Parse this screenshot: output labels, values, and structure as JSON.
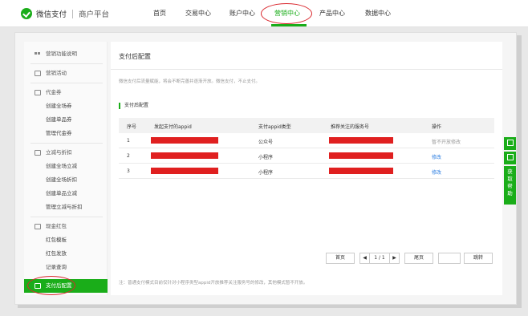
{
  "header": {
    "logo_text": "微信支付",
    "logo_sub": "商户平台",
    "nav": [
      {
        "label": "首页",
        "active": false
      },
      {
        "label": "交易中心",
        "active": false
      },
      {
        "label": "账户中心",
        "active": false
      },
      {
        "label": "营销中心",
        "active": true
      },
      {
        "label": "产品中心",
        "active": false
      },
      {
        "label": "数据中心",
        "active": false
      }
    ]
  },
  "sidebar": {
    "items": [
      {
        "label": "营销功能说明",
        "type": "group",
        "icon": "grid-icon"
      },
      {
        "label": "营销活动",
        "type": "group",
        "icon": "calendar-icon"
      },
      {
        "label": "代金券",
        "type": "group",
        "icon": "coupon-icon"
      },
      {
        "label": "创建全场券",
        "type": "sub"
      },
      {
        "label": "创建单品券",
        "type": "sub"
      },
      {
        "label": "管理代金券",
        "type": "sub"
      },
      {
        "label": "立减与折扣",
        "type": "group",
        "icon": "discount-icon"
      },
      {
        "label": "创建全场立减",
        "type": "sub"
      },
      {
        "label": "创建全场折扣",
        "type": "sub"
      },
      {
        "label": "创建单品立减",
        "type": "sub"
      },
      {
        "label": "管理立减与折扣",
        "type": "sub"
      },
      {
        "label": "现金红包",
        "type": "group",
        "icon": "redpacket-icon"
      },
      {
        "label": "红包模板",
        "type": "sub"
      },
      {
        "label": "红包发放",
        "type": "sub"
      },
      {
        "label": "记录查询",
        "type": "sub"
      },
      {
        "label": "支付后配置",
        "type": "active",
        "icon": "phone-icon"
      }
    ]
  },
  "main": {
    "title": "支付后配置",
    "notice": "微信支付后流量赋能，将会不断完善并逐渐开放。微信支付，不止支付。",
    "section_title": "支付后配置",
    "table": {
      "headers": [
        "序号",
        "发起支付的appid",
        "支付appid类型",
        "推荐关注的服务号",
        "操作"
      ],
      "rows": [
        {
          "index": "1",
          "type": "公众号",
          "action": "暂不开放修改",
          "action_style": "muted"
        },
        {
          "index": "2",
          "type": "小程序",
          "action": "修改",
          "action_style": "link"
        },
        {
          "index": "3",
          "type": "小程序",
          "action": "修改",
          "action_style": "link"
        }
      ]
    },
    "pager": {
      "first": "首页",
      "prev": "◀",
      "info": "1 / 1",
      "next": "▶",
      "last": "尾页",
      "jump_value": "",
      "jump": "跳转"
    },
    "footnote": "注：普通支付模式目前仅针对小程序类型appid开放推荐关注服务号的修改，其他模式暂不开放。"
  },
  "float_tabs": {
    "help_label": "获取帮助"
  },
  "colors": {
    "brand_green": "#1aad19",
    "highlight_red": "#d9262c",
    "redaction_red": "#e02020",
    "link_blue": "#2b7de1"
  }
}
